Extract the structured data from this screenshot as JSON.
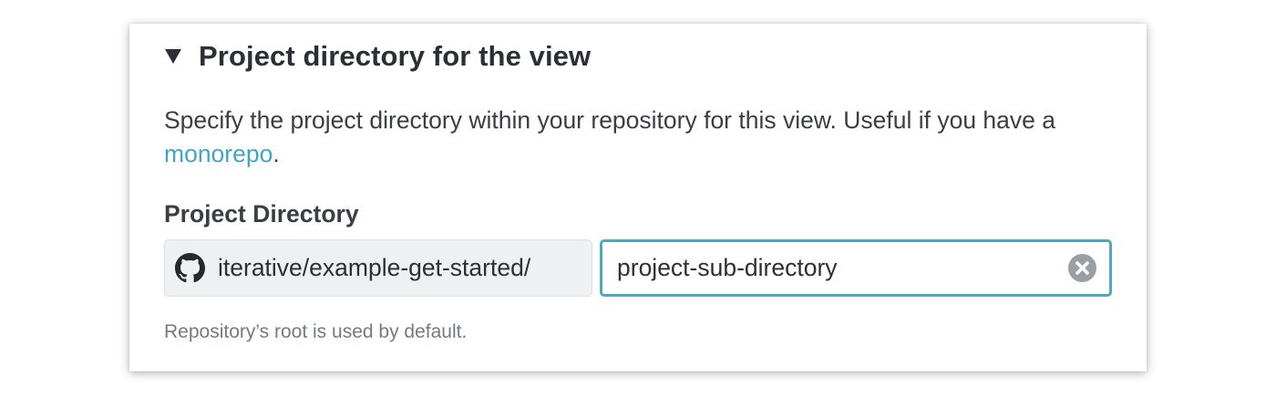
{
  "section": {
    "title": "Project directory for the view",
    "toggle_icon": "triangle-down-icon",
    "expanded": true
  },
  "description": {
    "text_before": "Specify the project directory within your repository for this view. Useful if you have a ",
    "link_text": "monorepo",
    "text_after": "."
  },
  "field": {
    "label": "Project Directory",
    "repo_icon": "github-icon",
    "prefix": "iterative/example-get-started/",
    "value": "project-sub-directory",
    "clear_icon": "clear-circle-icon",
    "help_text": "Repository’s root is used by default."
  },
  "colors": {
    "link": "#3fa7bf",
    "focus_border": "#4fa8bd",
    "prefix_bg": "#eff0f2",
    "help_text": "#737a84"
  }
}
